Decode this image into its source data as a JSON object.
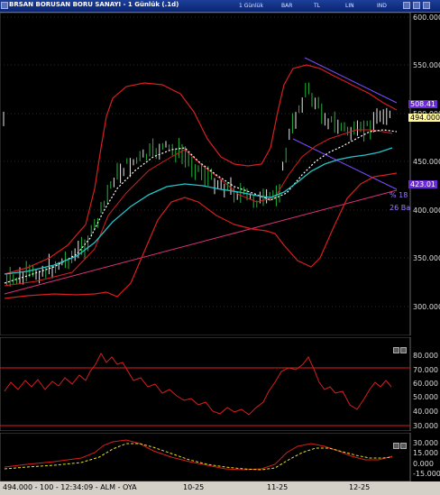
{
  "window": {
    "title": "BRSAN BORUSAN BORU SANAYI - 1 Günlük (.1d)",
    "buttons": [
      "1 Günlük",
      "BAR",
      "TL",
      "LIN",
      "IND"
    ]
  },
  "main_axis": {
    "ticks": [
      "600.000",
      "550.000",
      "500.000",
      "450.000",
      "400.000",
      "350.000",
      "300.000"
    ]
  },
  "price_tags": {
    "upper": "508.41",
    "last": "494.000",
    "lower": "423.01"
  },
  "side_labels": {
    "ma_label": "% 18",
    "ma_label2": "26 Ba"
  },
  "rsi_axis": {
    "ticks": [
      "80.000",
      "70.000",
      "60.000",
      "50.000",
      "40.000",
      "30.000"
    ]
  },
  "macd_axis": {
    "ticks": [
      "30.000",
      "15.000",
      "0.000",
      "-15.000"
    ]
  },
  "x_axis": {
    "ticks": [
      "10-25",
      "11-25",
      "12-25"
    ]
  },
  "status": {
    "text": "494.000 - 100 - 12:34:09 - ALM - OYA"
  },
  "colors": {
    "bollinger": "#d81e1e",
    "ma": "#27c3c9",
    "candles": "#23b23a",
    "trend": "#e0307a",
    "channel": "#7a4cff"
  }
}
